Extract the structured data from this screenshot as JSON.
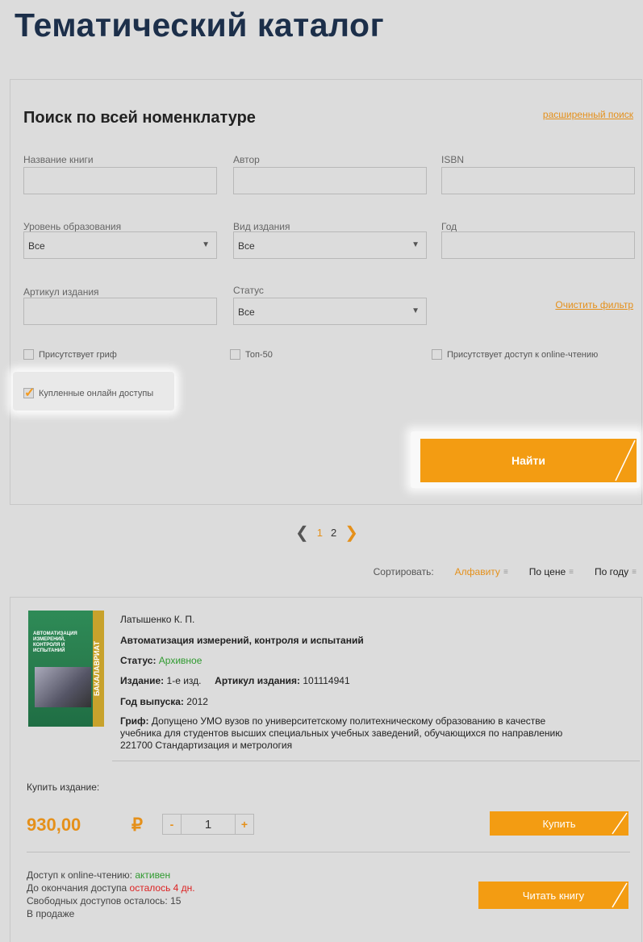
{
  "page": {
    "title": "Тематический каталог"
  },
  "search": {
    "title": "Поиск по всей номенклатуре",
    "advanced_link": "расширенный поиск",
    "fields": {
      "book_title": {
        "label": "Название книги",
        "value": ""
      },
      "author": {
        "label": "Автор",
        "value": ""
      },
      "isbn": {
        "label": "ISBN",
        "value": ""
      },
      "edu_level": {
        "label": "Уровень образования",
        "selected": "Все"
      },
      "edition_type": {
        "label": "Вид издания",
        "selected": "Все"
      },
      "year": {
        "label": "Год",
        "value": ""
      },
      "article": {
        "label": "Артикул издания",
        "value": ""
      },
      "status": {
        "label": "Статус",
        "selected": "Все"
      }
    },
    "clear_link": "Очистить фильтр",
    "checkboxes": {
      "grif": {
        "label": "Присутствует гриф",
        "checked": false
      },
      "top50": {
        "label": "Топ-50",
        "checked": false
      },
      "online": {
        "label": "Присутствует доступ к online-чтению",
        "checked": false
      },
      "purchased": {
        "label": "Купленные онлайн доступы",
        "checked": true
      }
    },
    "find_button": "Найти",
    "accent_color": "#f39c12"
  },
  "pagination": {
    "prev": "❮",
    "pages": [
      "1",
      "2"
    ],
    "current": "1",
    "next": "❯"
  },
  "sort": {
    "label": "Сортировать:",
    "options": [
      "Алфавиту",
      "По цене",
      "По году"
    ],
    "active": "Алфавиту"
  },
  "product": {
    "author": "Латышенко К. П.",
    "title": "Автоматизация измерений, контроля и испытаний",
    "cover_title": "АВТОМАТИЗАЦИЯ ИЗМЕРЕНИЙ, КОНТРОЛЯ И ИСПЫТАНИЙ",
    "cover_spine": "БАКАЛАВРИАТ",
    "status_label": "Статус:",
    "status_value": "Архивное",
    "edition_label": "Издание:",
    "edition_value": "1-е изд.",
    "article_label": "Артикул издания:",
    "article_value": "101114941",
    "year_label": "Год выпуска:",
    "year_value": "2012",
    "grif_label": "Гриф:",
    "grif_line1": "Допущено УМО вузов по университетскому политехническому образованию в качестве",
    "grif_line2": "учебника для студентов высших специальных учебных заведений, обучающихся по направлению",
    "grif_line3": "221700 Стандартизация и метрология",
    "buy_label": "Купить издание:",
    "price": "930,00",
    "currency": "₽",
    "qty_minus": "-",
    "qty_value": "1",
    "qty_plus": "+",
    "buy_button": "Купить",
    "online_label": "Доступ к online-чтению:",
    "online_value": "активен",
    "expiry_label": "До окончания доступа",
    "expiry_value": "осталось 4 дн.",
    "free_access": "Свободных доступов осталось: 15",
    "on_sale": "В продаже",
    "read_button": "Читать книгу"
  }
}
